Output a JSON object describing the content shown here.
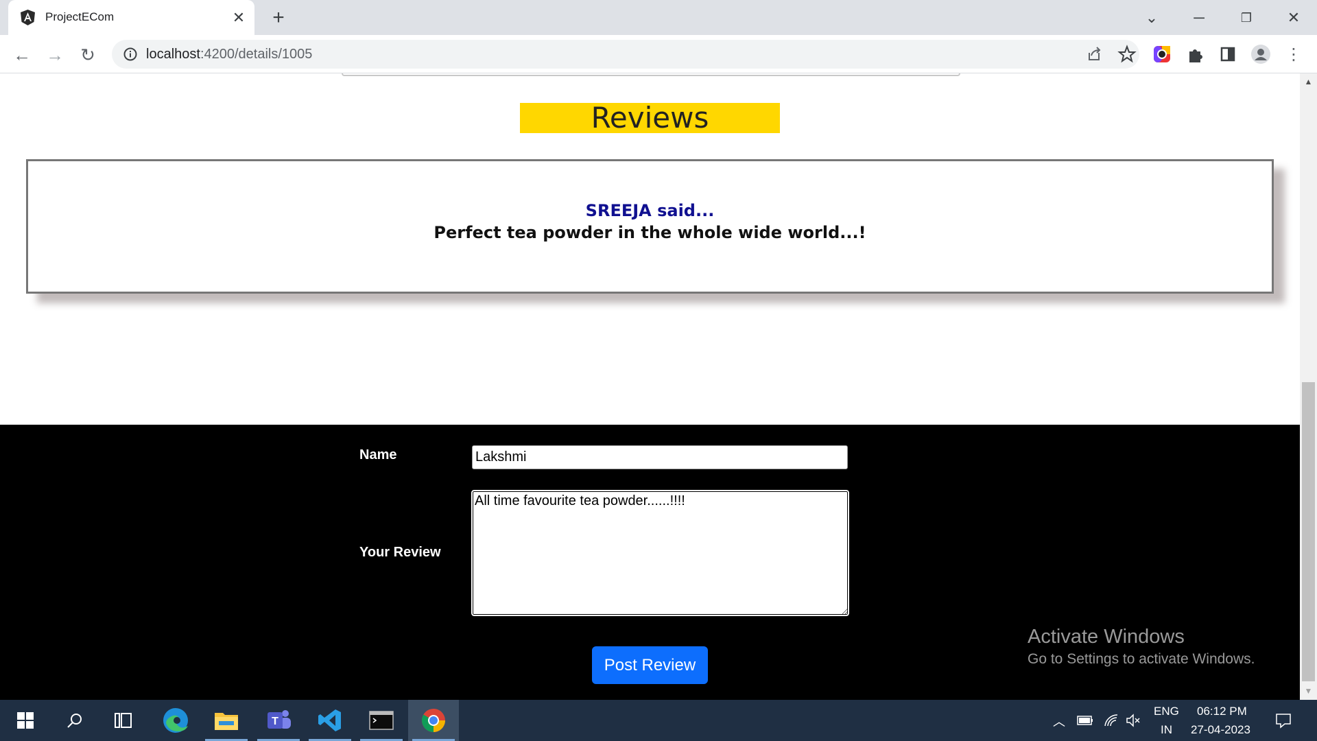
{
  "browser": {
    "tab_title": "ProjectECom",
    "url_host": "localhost",
    "url_path": ":4200/details/1005"
  },
  "page": {
    "reviews_heading": "Reviews",
    "reviews": [
      {
        "author_line": "SREEJA said...",
        "text": "Perfect tea powder in the whole wide world...!"
      }
    ],
    "form": {
      "name_label": "Name",
      "name_value": "Lakshmi",
      "review_label": "Your Review",
      "review_value": "All time favourite tea powder......!!!!",
      "submit_label": "Post Review"
    },
    "watermark": {
      "title": "Activate Windows",
      "subtitle": "Go to Settings to activate Windows."
    }
  },
  "taskbar": {
    "apps": [
      "start-icon",
      "search-icon",
      "task-view-icon",
      "edge-icon",
      "file-explorer-icon",
      "teams-icon",
      "vscode-icon",
      "terminal-icon",
      "chrome-icon"
    ],
    "language_top": "ENG",
    "language_bottom": "IN",
    "time": "06:12 PM",
    "date": "27-04-2023"
  },
  "colors": {
    "reviews_heading_bg": "#ffd700",
    "author_color": "#101090",
    "button_bg": "#0d6efd",
    "form_bg": "#000000",
    "taskbar_bg": "#1f2f43"
  }
}
